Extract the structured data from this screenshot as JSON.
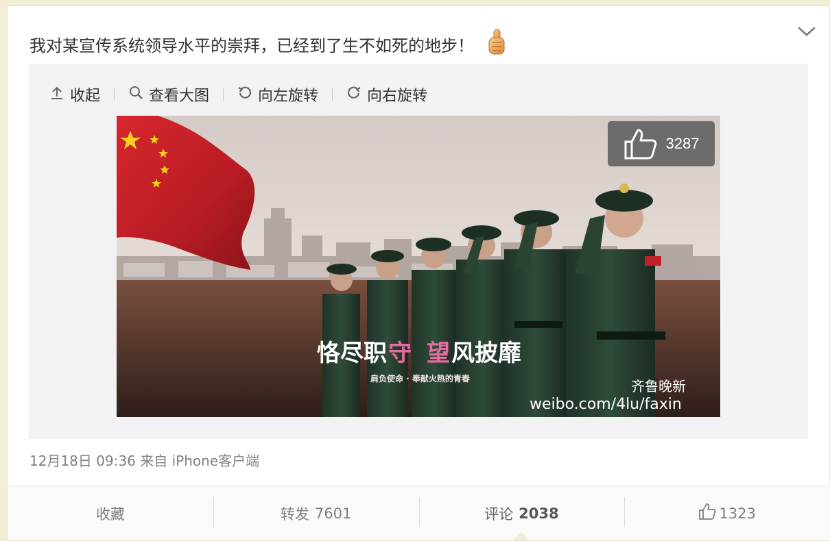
{
  "post": {
    "text": "我对某宣传系统领导水平的崇拜，已经到了生不如死的地步！",
    "emoji_icon": "thumbs-up-emoji-icon"
  },
  "toolbar": {
    "collapse": "收起",
    "view_large": "查看大图",
    "rotate_left": "向左旋转",
    "rotate_right": "向右旋转"
  },
  "image": {
    "like_count": "3287",
    "slogan_left": "恪尽职",
    "slogan_mid": "守",
    "slogan_right_a": "望",
    "slogan_right_b": "风披靡",
    "tagline": "肩负使命 · 奉献火热的青春",
    "watermark_name": "齐鲁晚新",
    "watermark_url": "weibo.com/4lu/faxin"
  },
  "meta": {
    "time": "12月18日 09:36",
    "from_label": "来自",
    "source": "iPhone客户端"
  },
  "actions": {
    "favorite": "收藏",
    "repost_label": "转发",
    "repost_count": "7601",
    "comment_label": "评论",
    "comment_count": "2038",
    "like_count": "1323"
  },
  "colors": {
    "page_bg": "#f2edd5",
    "flag_red": "#c8202a",
    "overlay": "#505050",
    "text_gray": "#808080"
  }
}
